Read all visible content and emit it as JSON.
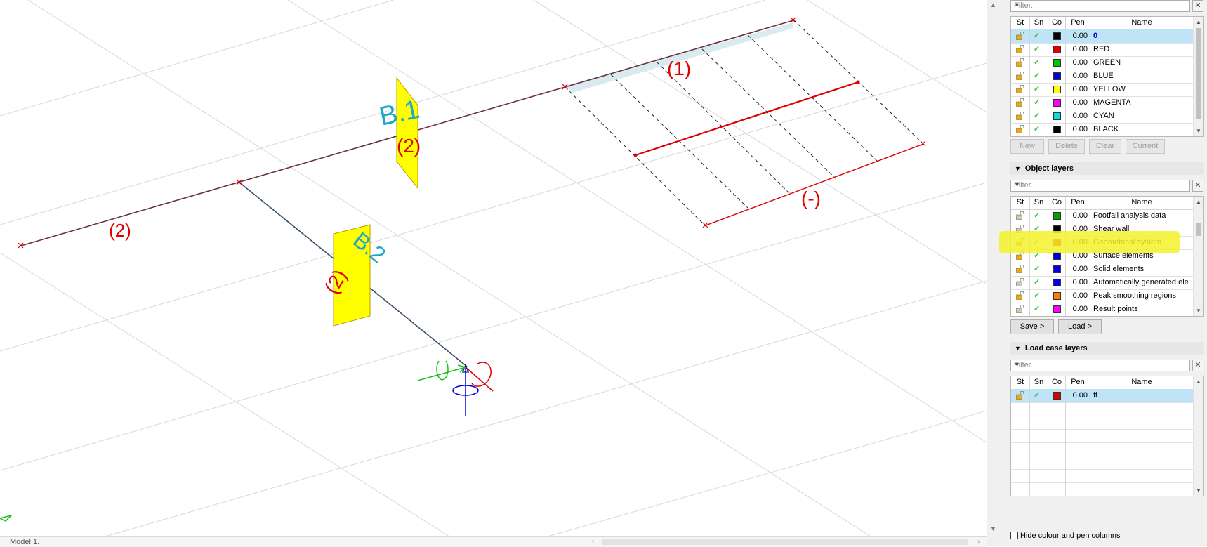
{
  "colors": {
    "red": "#e00000",
    "teal_label": "#1ea8c8",
    "wall_yellow": "#ffff00",
    "selection": "#bfe3f7",
    "highlighter": "#f2f22a"
  },
  "viewport": {
    "labels": {
      "b1": "B.1",
      "b2": "B.2",
      "beam_left": "(2)",
      "wall_b1": "(2)",
      "wall_b2": "(2)",
      "top_right": "(1)",
      "slab_edge": "(-)"
    },
    "tab_label": "Model 1."
  },
  "layers": {
    "filter_placeholder": "Filter...",
    "columns": [
      "St",
      "Sn",
      "Co",
      "Pen",
      "Name"
    ],
    "rows": [
      {
        "pen": "0.00",
        "name": "0",
        "color": "#000000",
        "selected": true
      },
      {
        "pen": "0.00",
        "name": "RED",
        "color": "#e00000"
      },
      {
        "pen": "0.00",
        "name": "GREEN",
        "color": "#00c800"
      },
      {
        "pen": "0.00",
        "name": "BLUE",
        "color": "#0000e0"
      },
      {
        "pen": "0.00",
        "name": "YELLOW",
        "color": "#ffff00"
      },
      {
        "pen": "0.00",
        "name": "MAGENTA",
        "color": "#ff00ff"
      },
      {
        "pen": "0.00",
        "name": "CYAN",
        "color": "#00e0e0"
      },
      {
        "pen": "0.00",
        "name": "BLACK",
        "color": "#000000"
      }
    ],
    "buttons": {
      "new": "New",
      "delete": "Delete",
      "clear": "Clear",
      "current": "Current"
    }
  },
  "object_layers": {
    "title": "Object layers",
    "filter_placeholder": "Filter...",
    "columns": [
      "St",
      "Sn",
      "Co",
      "Pen",
      "Name"
    ],
    "rows": [
      {
        "pen": "0.00",
        "name": "Footfall analysis data",
        "color": "#00a000",
        "locked": false
      },
      {
        "pen": "0.00",
        "name": "Shear wall",
        "color": "#000000",
        "locked": false
      },
      {
        "pen": "0.00",
        "name": "Geometrical system",
        "color": "#e00000",
        "locked": true
      },
      {
        "pen": "0.00",
        "name": "Surface elements",
        "color": "#0000e0",
        "locked": true
      },
      {
        "pen": "0.00",
        "name": "Solid elements",
        "color": "#0000e0",
        "locked": true
      },
      {
        "pen": "0.00",
        "name": "Automatically generated ele",
        "color": "#0000e0",
        "locked": false
      },
      {
        "pen": "0.00",
        "name": "Peak smoothing regions",
        "color": "#ff8000",
        "locked": true
      },
      {
        "pen": "0.00",
        "name": "Result points",
        "color": "#ff00ff",
        "locked": false
      }
    ],
    "buttons": {
      "save": "Save >",
      "load": "Load >"
    }
  },
  "load_case_layers": {
    "title": "Load case layers",
    "filter_placeholder": "Filter...",
    "columns": [
      "St",
      "Sn",
      "Co",
      "Pen",
      "Name"
    ],
    "rows": [
      {
        "pen": "0.00",
        "name": "ff",
        "color": "#e00000",
        "selected": true
      }
    ]
  },
  "options": {
    "hide_columns_label": "Hide colour and pen columns"
  }
}
